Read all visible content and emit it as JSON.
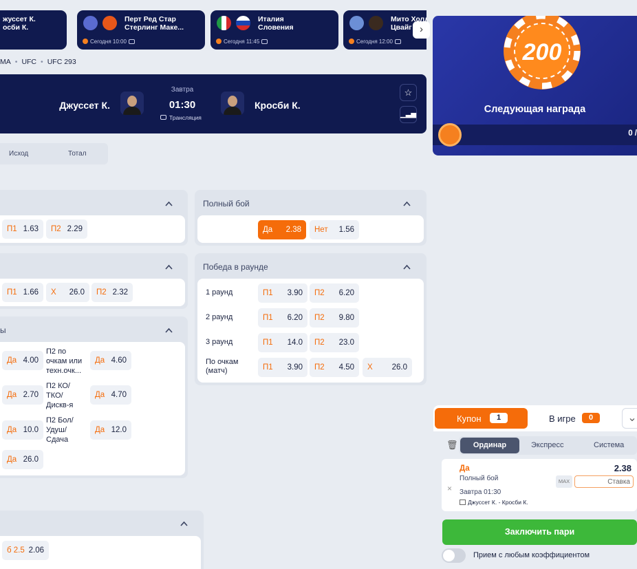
{
  "top_matches": [
    {
      "team1": "жуссет К.",
      "team2": "осби К.",
      "time": ""
    },
    {
      "team1": "Перт Ред Стар",
      "team2": "Стерлинг Маке...",
      "time": "Сегодня 10:00"
    },
    {
      "team1": "Италия",
      "team2": "Словения",
      "time": "Сегодня 11:45"
    },
    {
      "team1": "Мито Холл",
      "team2": "Цвайг",
      "time": "Сегодня 12:00"
    }
  ],
  "breadcrumb": [
    "MA",
    "UFC",
    "UFC 293"
  ],
  "event": {
    "fighter1": "Джуссет К.",
    "fighter2": "Кросби К.",
    "day": "Завтра",
    "time": "01:30",
    "broadcast": "Трансляция"
  },
  "tabs": [
    "Исход",
    "Тотал"
  ],
  "blocks": {
    "b1": {
      "odds": [
        {
          "l": "П1",
          "v": "1.63"
        },
        {
          "l": "П2",
          "v": "2.29"
        }
      ]
    },
    "b2": {
      "odds": [
        {
          "l": "П1",
          "v": "1.66"
        },
        {
          "l": "X",
          "v": "26.0"
        },
        {
          "l": "П2",
          "v": "2.32"
        }
      ]
    },
    "b3": {
      "title": "ы",
      "rows": [
        {
          "l": "Да",
          "v": "4.00",
          "text": "П2 по очкам или техн.очк...",
          "l2": "Да",
          "v2": "4.60"
        },
        {
          "l": "Да",
          "v": "2.70",
          "text": "П2 КО/ТКО/ Дискв-я",
          "l2": "Да",
          "v2": "4.70"
        },
        {
          "l": "Да",
          "v": "10.0",
          "text": "П2 Бол/ Удуш/ Сдача",
          "l2": "Да",
          "v2": "12.0"
        },
        {
          "l": "Да",
          "v": "26.0"
        }
      ]
    },
    "full": {
      "title": "Полный бой",
      "odds": [
        {
          "l": "Да",
          "v": "2.38"
        },
        {
          "l": "Нет",
          "v": "1.56"
        }
      ]
    },
    "round": {
      "title": "Победа в раунде",
      "rows": [
        {
          "name": "1 раунд",
          "o": [
            {
              "l": "П1",
              "v": "3.90"
            },
            {
              "l": "П2",
              "v": "6.20"
            }
          ]
        },
        {
          "name": "2 раунд",
          "o": [
            {
              "l": "П1",
              "v": "6.20"
            },
            {
              "l": "П2",
              "v": "9.80"
            }
          ]
        },
        {
          "name": "3 раунд",
          "o": [
            {
              "l": "П1",
              "v": "14.0"
            },
            {
              "l": "П2",
              "v": "23.0"
            }
          ]
        },
        {
          "name": "По очкам (матч)",
          "o": [
            {
              "l": "П1",
              "v": "3.90"
            },
            {
              "l": "П2",
              "v": "4.50"
            },
            {
              "l": "X",
              "v": "26.0"
            }
          ]
        }
      ]
    },
    "b5": {
      "odds": [
        {
          "l": "б 2.5",
          "v": "2.06"
        }
      ]
    }
  },
  "reward": {
    "amount": "200",
    "title": "Следующая награда",
    "progress": "0 /"
  },
  "coupon": {
    "tab1": "Купон",
    "tab1_count": "1",
    "tab2": "В игре",
    "tab2_count": "0",
    "types": [
      "Ординар",
      "Экспресс",
      "Система"
    ],
    "bet": {
      "pick": "Да",
      "odd": "2.38",
      "market": "Полный бой",
      "max": "MAX",
      "stake_placeholder": "Ставка",
      "date": "Завтра 01:30",
      "teams": "Джуссет К. - Кросби К."
    },
    "submit": "Заключить пари",
    "accept_any": "Прием с любым коэффициентом"
  },
  "colors": {
    "navy": "#101a4f",
    "orange": "#f56c0a",
    "green": "#3db83a"
  }
}
